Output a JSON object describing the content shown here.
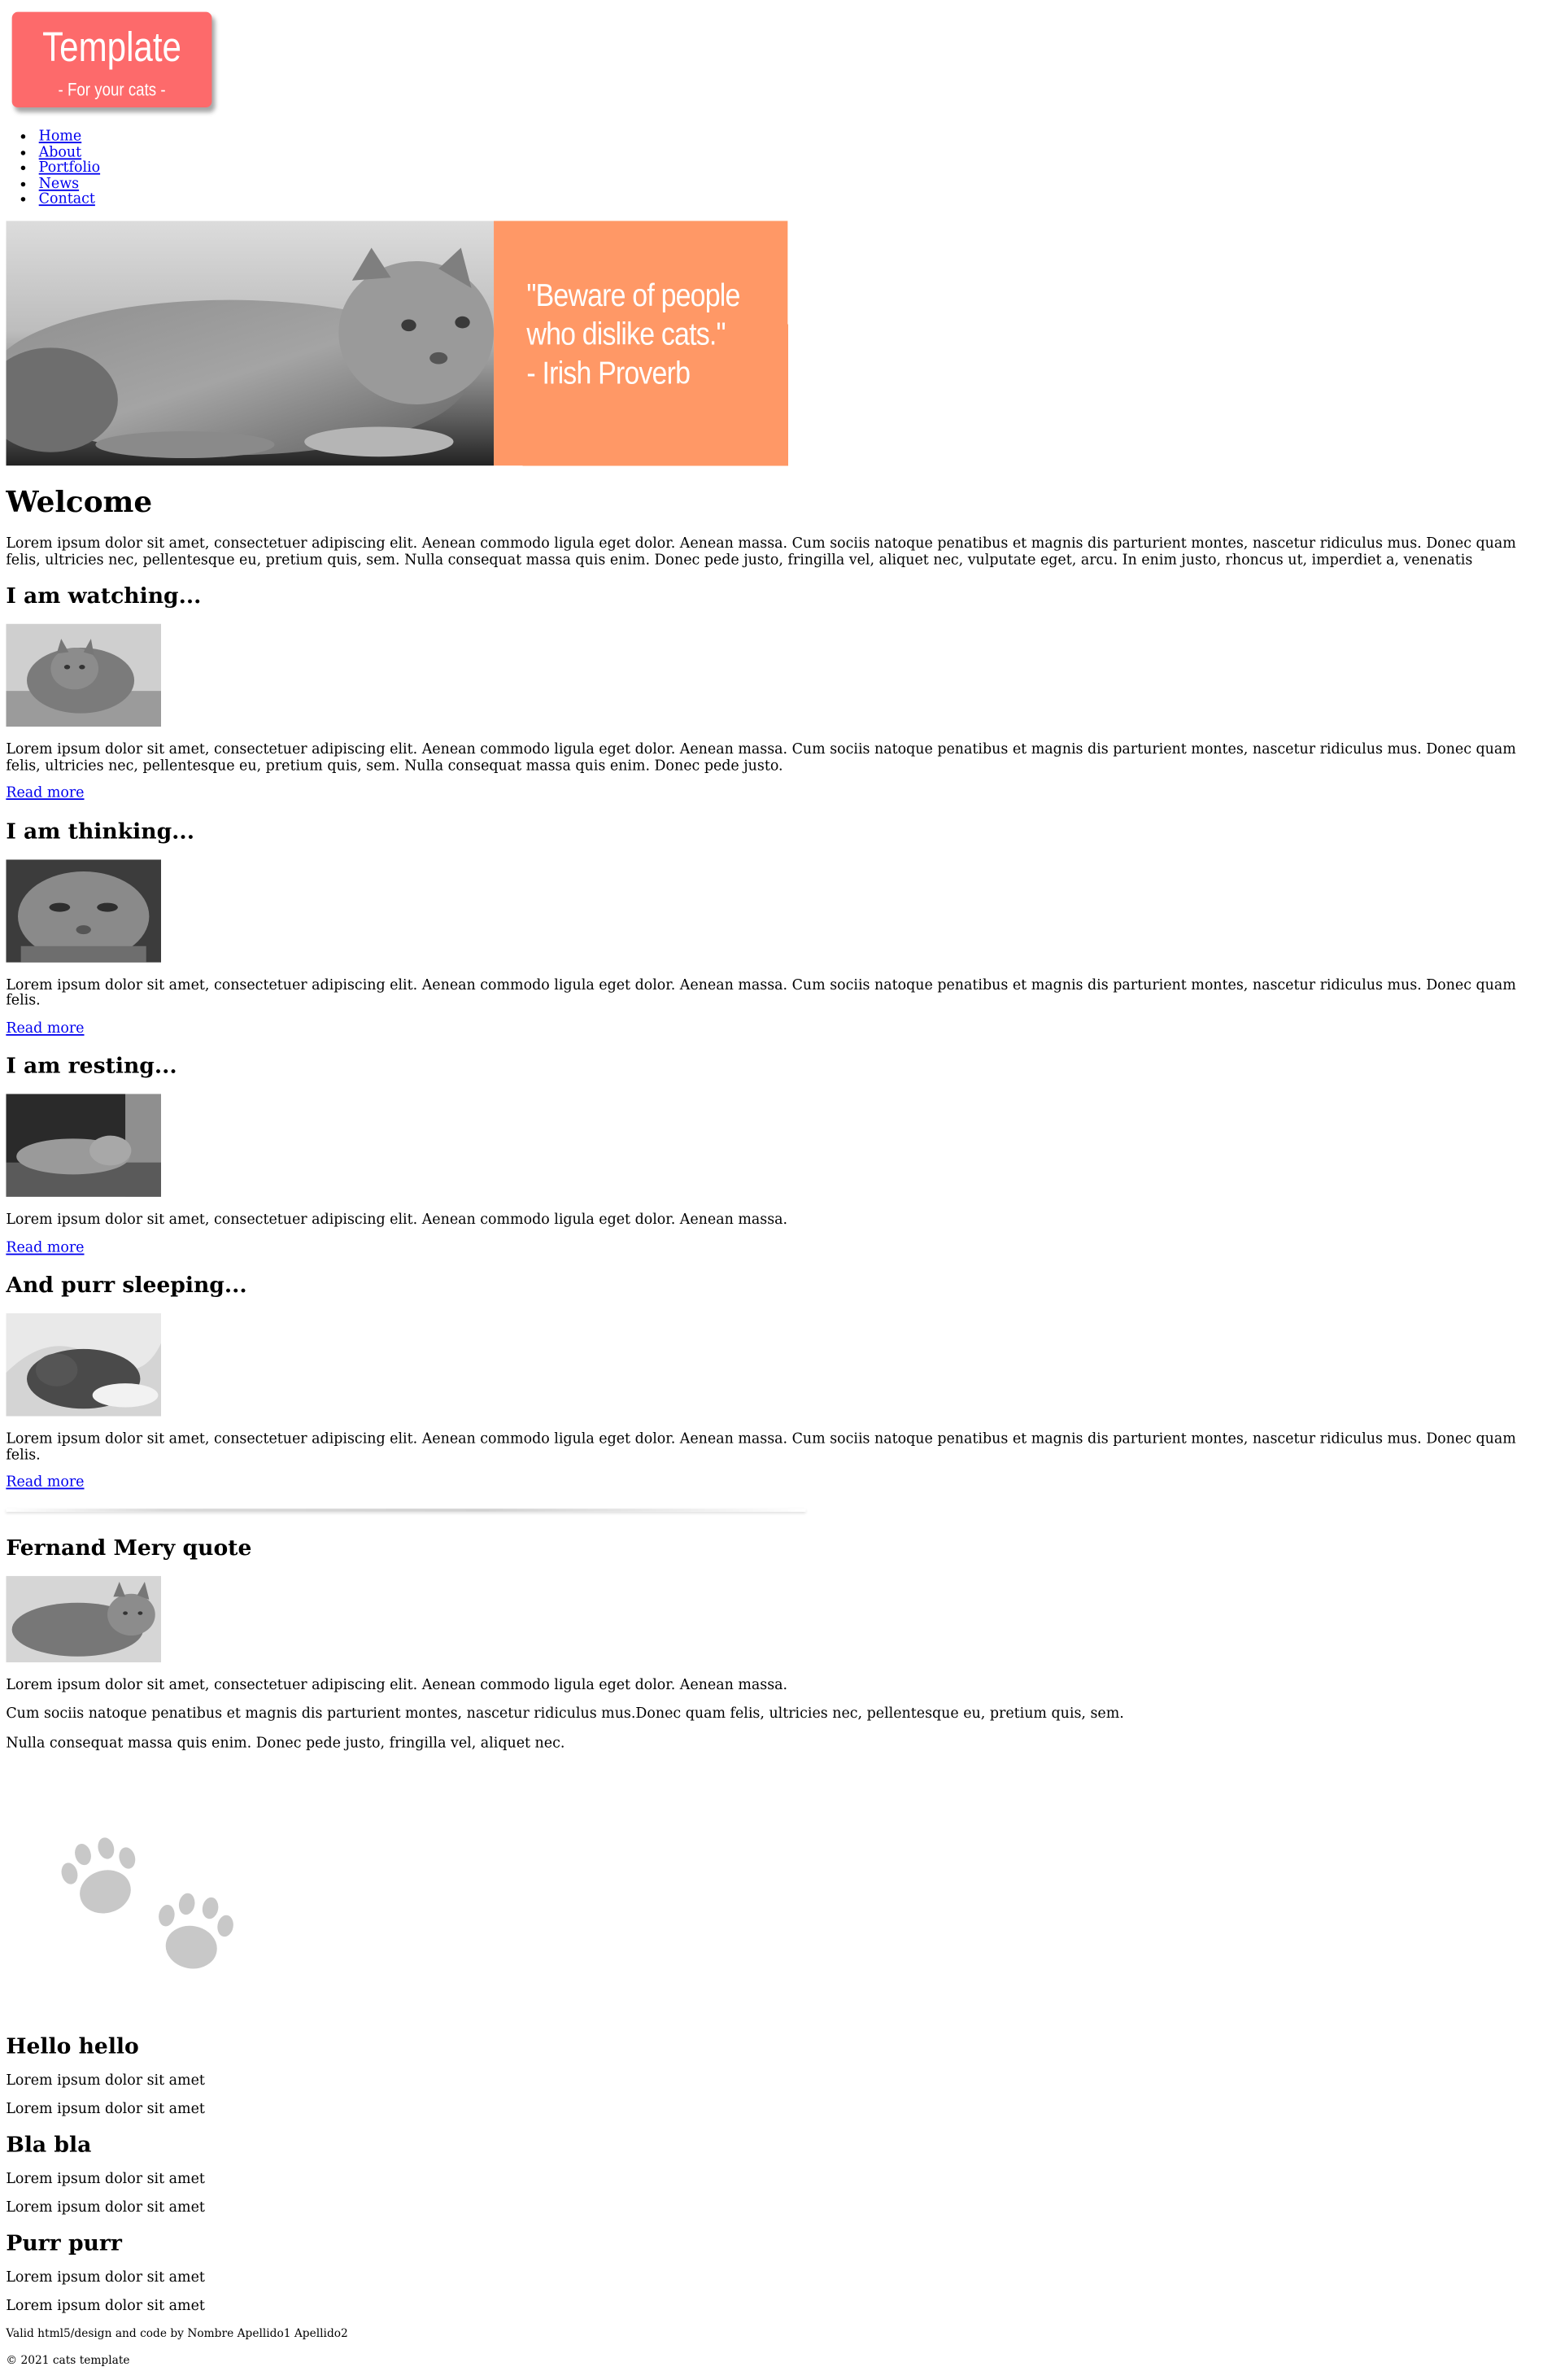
{
  "header": {
    "logo_title": "Template",
    "logo_subtitle": "- For your cats -",
    "accent": "#fd6a6b"
  },
  "nav": {
    "items": [
      "Home",
      "About",
      "Portfolio",
      "News",
      "Contact"
    ]
  },
  "hero": {
    "quote_line1": "\"Beware of people",
    "quote_line2": "who dislike cats.\"",
    "quote_line3": "- Irish Proverb",
    "quote_bg": "#ff9866"
  },
  "welcome": {
    "title": "Welcome",
    "text": "Lorem ipsum dolor sit amet, consectetuer adipiscing elit. Aenean commodo ligula eget dolor. Aenean massa. Cum sociis natoque penatibus et magnis dis parturient montes, nascetur ridiculus mus. Donec quam felis, ultricies nec, pellentesque eu, pretium quis, sem. Nulla consequat massa quis enim. Donec pede justo, fringilla vel, aliquet nec, vulputate eget, arcu. In enim justo, rhoncus ut, imperdiet a, venenatis"
  },
  "posts": [
    {
      "title": "I am watching...",
      "text": "Lorem ipsum dolor sit amet, consectetuer adipiscing elit. Aenean commodo ligula eget dolor. Aenean massa. Cum sociis natoque penatibus et magnis dis parturient montes, nascetur ridiculus mus. Donec quam felis, ultricies nec, pellentesque eu, pretium quis, sem. Nulla consequat massa quis enim. Donec pede justo.",
      "link": "Read more"
    },
    {
      "title": "I am thinking...",
      "text": "Lorem ipsum dolor sit amet, consectetuer adipiscing elit. Aenean commodo ligula eget dolor. Aenean massa. Cum sociis natoque penatibus et magnis dis parturient montes, nascetur ridiculus mus. Donec quam felis.",
      "link": "Read more"
    },
    {
      "title": "I am resting...",
      "text": "Lorem ipsum dolor sit amet, consectetuer adipiscing elit. Aenean commodo ligula eget dolor. Aenean massa.",
      "link": "Read more"
    },
    {
      "title": "And purr sleeping...",
      "text": "Lorem ipsum dolor sit amet, consectetuer adipiscing elit. Aenean commodo ligula eget dolor. Aenean massa. Cum sociis natoque penatibus et magnis dis parturient montes, nascetur ridiculus mus. Donec quam felis.",
      "link": "Read more"
    }
  ],
  "quote_section": {
    "title": "Fernand Mery quote",
    "p1": "Lorem ipsum dolor sit amet, consectetuer adipiscing elit. Aenean commodo ligula eget dolor. Aenean massa.",
    "p2": "Cum sociis natoque penatibus et magnis dis parturient montes, nascetur ridiculus mus.Donec quam felis, ultricies nec, pellentesque eu, pretium quis, sem.",
    "p3": "Nulla consequat massa quis enim. Donec pede justo, fringilla vel, aliquet nec."
  },
  "sections": [
    {
      "title": "Hello hello",
      "line1": "Lorem ipsum dolor sit amet",
      "line2": "Lorem ipsum dolor sit amet"
    },
    {
      "title": "Bla bla",
      "line1": "Lorem ipsum dolor sit amet",
      "line2": "Lorem ipsum dolor sit amet"
    },
    {
      "title": "Purr purr",
      "line1": "Lorem ipsum dolor sit amet",
      "line2": "Lorem ipsum dolor sit amet"
    }
  ],
  "footer": {
    "credit": "Valid html5/design and code by Nombre Apellido1 Apellido2",
    "copyright": "© 2021 cats template"
  },
  "icons": {
    "paws": "paw-prints-icon"
  }
}
